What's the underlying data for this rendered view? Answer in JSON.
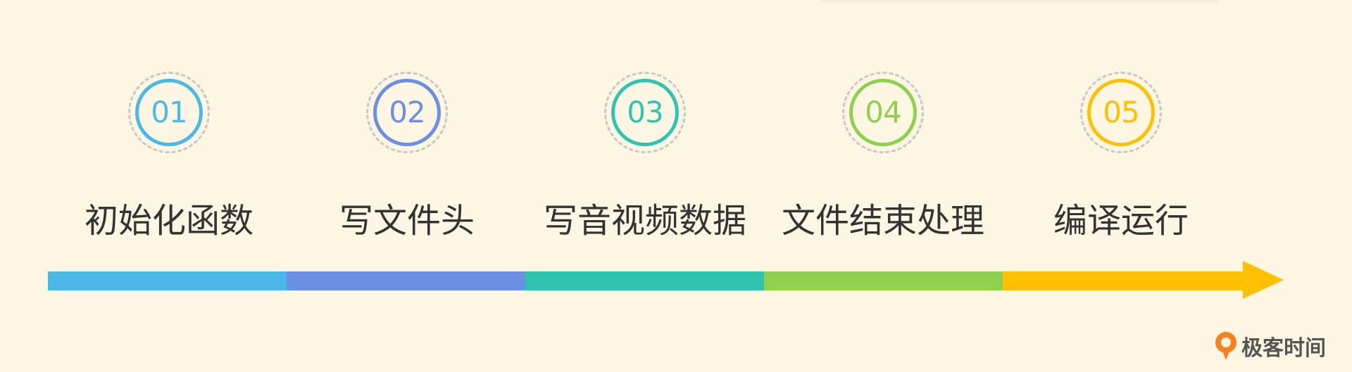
{
  "steps": [
    {
      "number": "01",
      "label": "初始化函数",
      "color": "#4cb8e8"
    },
    {
      "number": "02",
      "label": "写文件头",
      "color": "#6b8fe3"
    },
    {
      "number": "03",
      "label": "写音视频数据",
      "color": "#2fc4b2"
    },
    {
      "number": "04",
      "label": "文件结束处理",
      "color": "#8fd14f"
    },
    {
      "number": "05",
      "label": "编译运行",
      "color": "#ffc000"
    }
  ],
  "timeline": {
    "colors": [
      "#4cb8e8",
      "#6b8fe3",
      "#2fc4b2",
      "#8fd14f",
      "#ffc000"
    ]
  },
  "brand": {
    "name": "极客时间",
    "color": "#f5811f",
    "icon": "geektime-logo-icon"
  }
}
